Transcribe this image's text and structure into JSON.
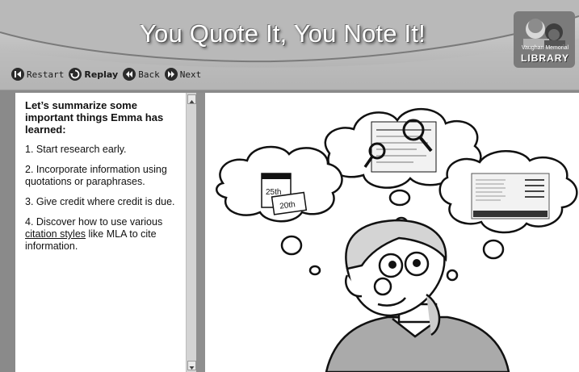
{
  "header": {
    "title": "You Quote It, You Note It!",
    "logo": {
      "small_text": "Vaughan Memorial",
      "big_text": "LIBRARY"
    }
  },
  "nav": {
    "restart_label": "Restart",
    "replay_label": "Replay",
    "back_label": "Back",
    "next_label": "Next"
  },
  "summary": {
    "heading": "Let’s summarize some important things Emma has learned:",
    "item1": "1. Start research early.",
    "item2": "2. Incorporate information using quotations or paraphrases.",
    "item3": "3. Give credit where credit is due.",
    "item4_before": "4. Discover how to use various ",
    "item4_link": "citation styles",
    "item4_after": " like MLA to cite information."
  },
  "scene": {
    "calendar_date_1": "25th",
    "calendar_date_2": "20th"
  },
  "colors": {
    "header_gradient_top": "#d7d7d7",
    "header_gradient_bottom": "#a9a9a9",
    "frame": "#8a8a8a",
    "text": "#111111"
  }
}
